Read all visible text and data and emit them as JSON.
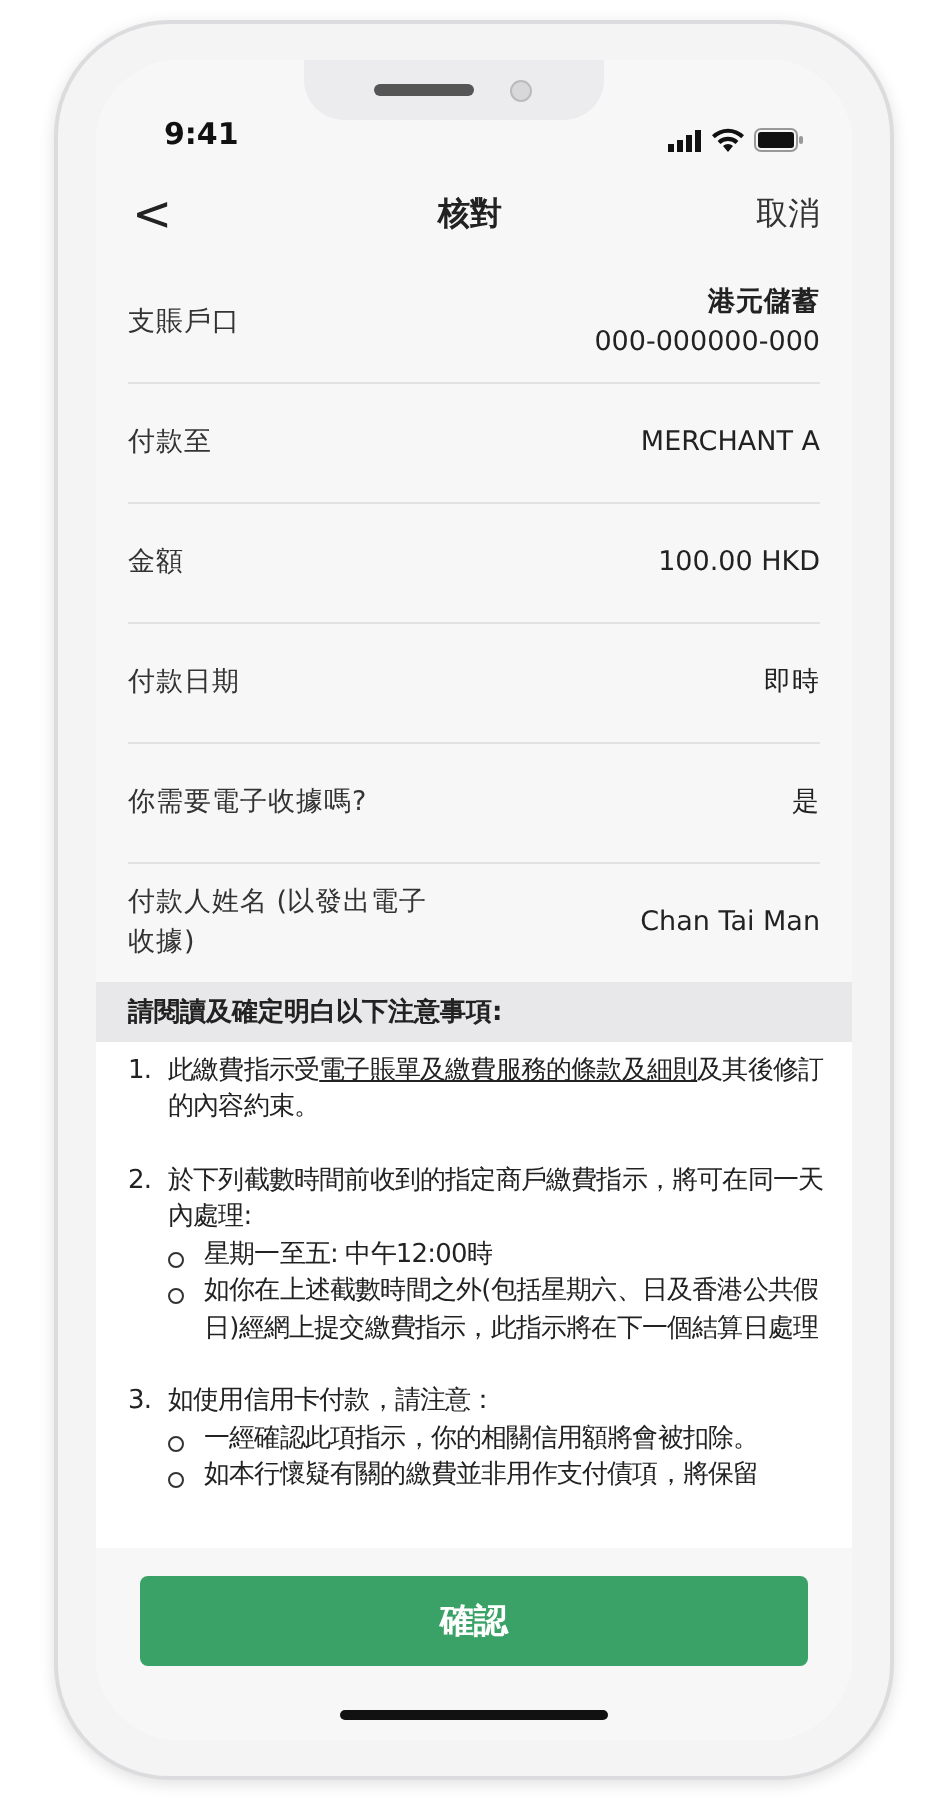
{
  "status_bar": {
    "time": "9:41"
  },
  "nav": {
    "back": "<",
    "title": "核對",
    "cancel": "取消"
  },
  "rows": [
    {
      "label": "支賬戶口",
      "values": [
        "港元儲蓄",
        "000-000000-000"
      ]
    },
    {
      "label": "付款至",
      "values": [
        "MERCHANT A"
      ]
    },
    {
      "label": "金額",
      "values": [
        "100.00 HKD"
      ]
    },
    {
      "label": "付款日期",
      "values": [
        "即時"
      ]
    },
    {
      "label": "你需要電子收據嗎?",
      "values": [
        "是"
      ]
    },
    {
      "label": "付款人姓名 (以發出電子收據)",
      "values": [
        "Chan Tai Man"
      ]
    }
  ],
  "notice": {
    "heading": "請閱讀及確定明白以下注意事項:",
    "items": [
      {
        "number": "1.",
        "before": "此繳費指示受",
        "link": "電子賬單及繳費服務的條款及細則",
        "after": "及其後修訂的內容約束。"
      },
      {
        "number": "2.",
        "before": "於下列截數時間前收到的指定商戶繳費指示，將可在同一天內處理:",
        "bullets": [
          "星期一至五: 中午12:00時",
          "如你在上述截數時間之外(包括星期六、日及香港公共假日)經網上提交繳費指示，此指示將在下一個結算日處理"
        ]
      },
      {
        "number": "3.",
        "before": "如使用信用卡付款，請注意：",
        "bullets": [
          "一經確認此項指示，你的相關信用額將會被扣除。",
          "如本行懷疑有關的繳費並非用作支付債項，將保留"
        ]
      }
    ]
  },
  "confirm_button": "確認"
}
